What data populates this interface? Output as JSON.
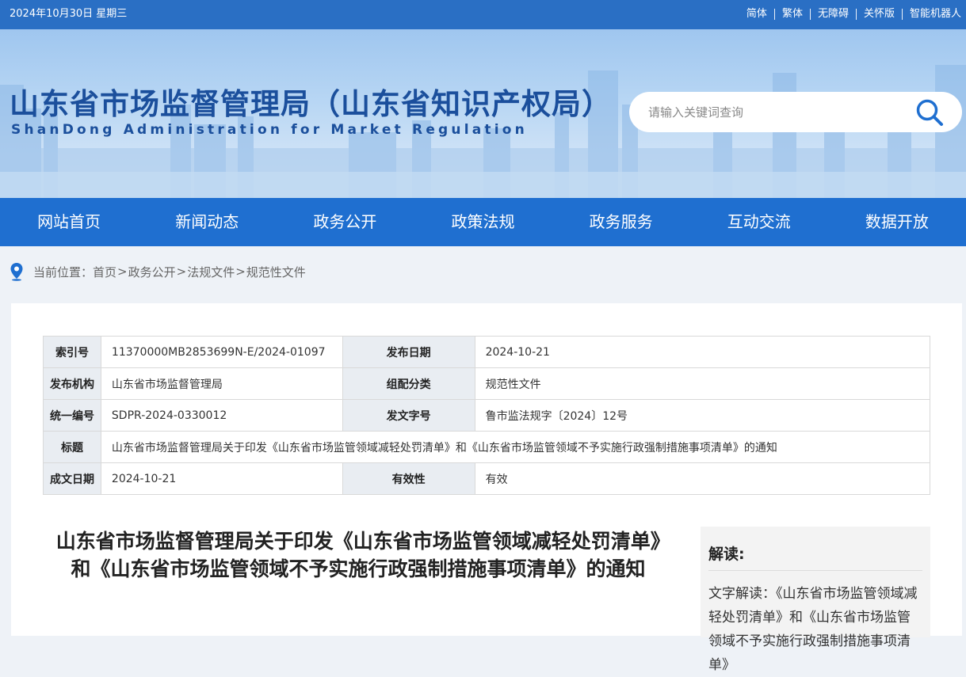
{
  "topbar": {
    "date": "2024年10月30日 星期三",
    "links": [
      "简体",
      "繁体",
      "无障碍",
      "关怀版",
      "智能机器人"
    ]
  },
  "header": {
    "title": "山东省市场监督管理局（山东省知识产权局）",
    "subtitle": "ShanDong Administration for Market Regulation",
    "search_placeholder": "请输入关键词查询"
  },
  "nav": {
    "items": [
      "网站首页",
      "新闻动态",
      "政务公开",
      "政策法规",
      "政务服务",
      "互动交流",
      "数据开放"
    ]
  },
  "breadcrumb": {
    "prefix": "当前位置：",
    "items": [
      "首页",
      "政务公开",
      "法规文件",
      "规范性文件"
    ],
    "separator": ">"
  },
  "info_table": {
    "index_label": "索引号",
    "index_value": "11370000MB2853699N-E/2024-01097",
    "pubdate_label": "发布日期",
    "pubdate_value": "2024-10-21",
    "issuer_label": "发布机构",
    "issuer_value": "山东省市场监督管理局",
    "category_label": "组配分类",
    "category_value": "规范性文件",
    "code_label": "统一编号",
    "code_value": "SDPR-2024-0330012",
    "docno_label": "发文字号",
    "docno_value": "鲁市监法规字〔2024〕12号",
    "title_label": "标题",
    "title_value": "山东省市场监督管理局关于印发《山东省市场监管领域减轻处罚清单》和《山东省市场监管领域不予实施行政强制措施事项清单》的通知",
    "created_label": "成文日期",
    "created_value": "2024-10-21",
    "validity_label": "有效性",
    "validity_value": "有效"
  },
  "article": {
    "title": "山东省市场监督管理局关于印发《山东省市场监管领域减轻处罚清单》和《山东省市场监管领域不予实施行政强制措施事项清单》的通知"
  },
  "sidebar": {
    "heading": "解读:",
    "link_text": "文字解读：《山东省市场监管领域减轻处罚清单》和《山东省市场监管领域不予实施行政强制措施事项清单》"
  },
  "colors": {
    "topbar": "#2a6fc4",
    "nav": "#1f6fd0",
    "title_blue": "#1b4f9c",
    "table_header_bg": "#e9edf2"
  },
  "icons": {
    "search": "search-icon",
    "location": "location-pin-icon"
  }
}
